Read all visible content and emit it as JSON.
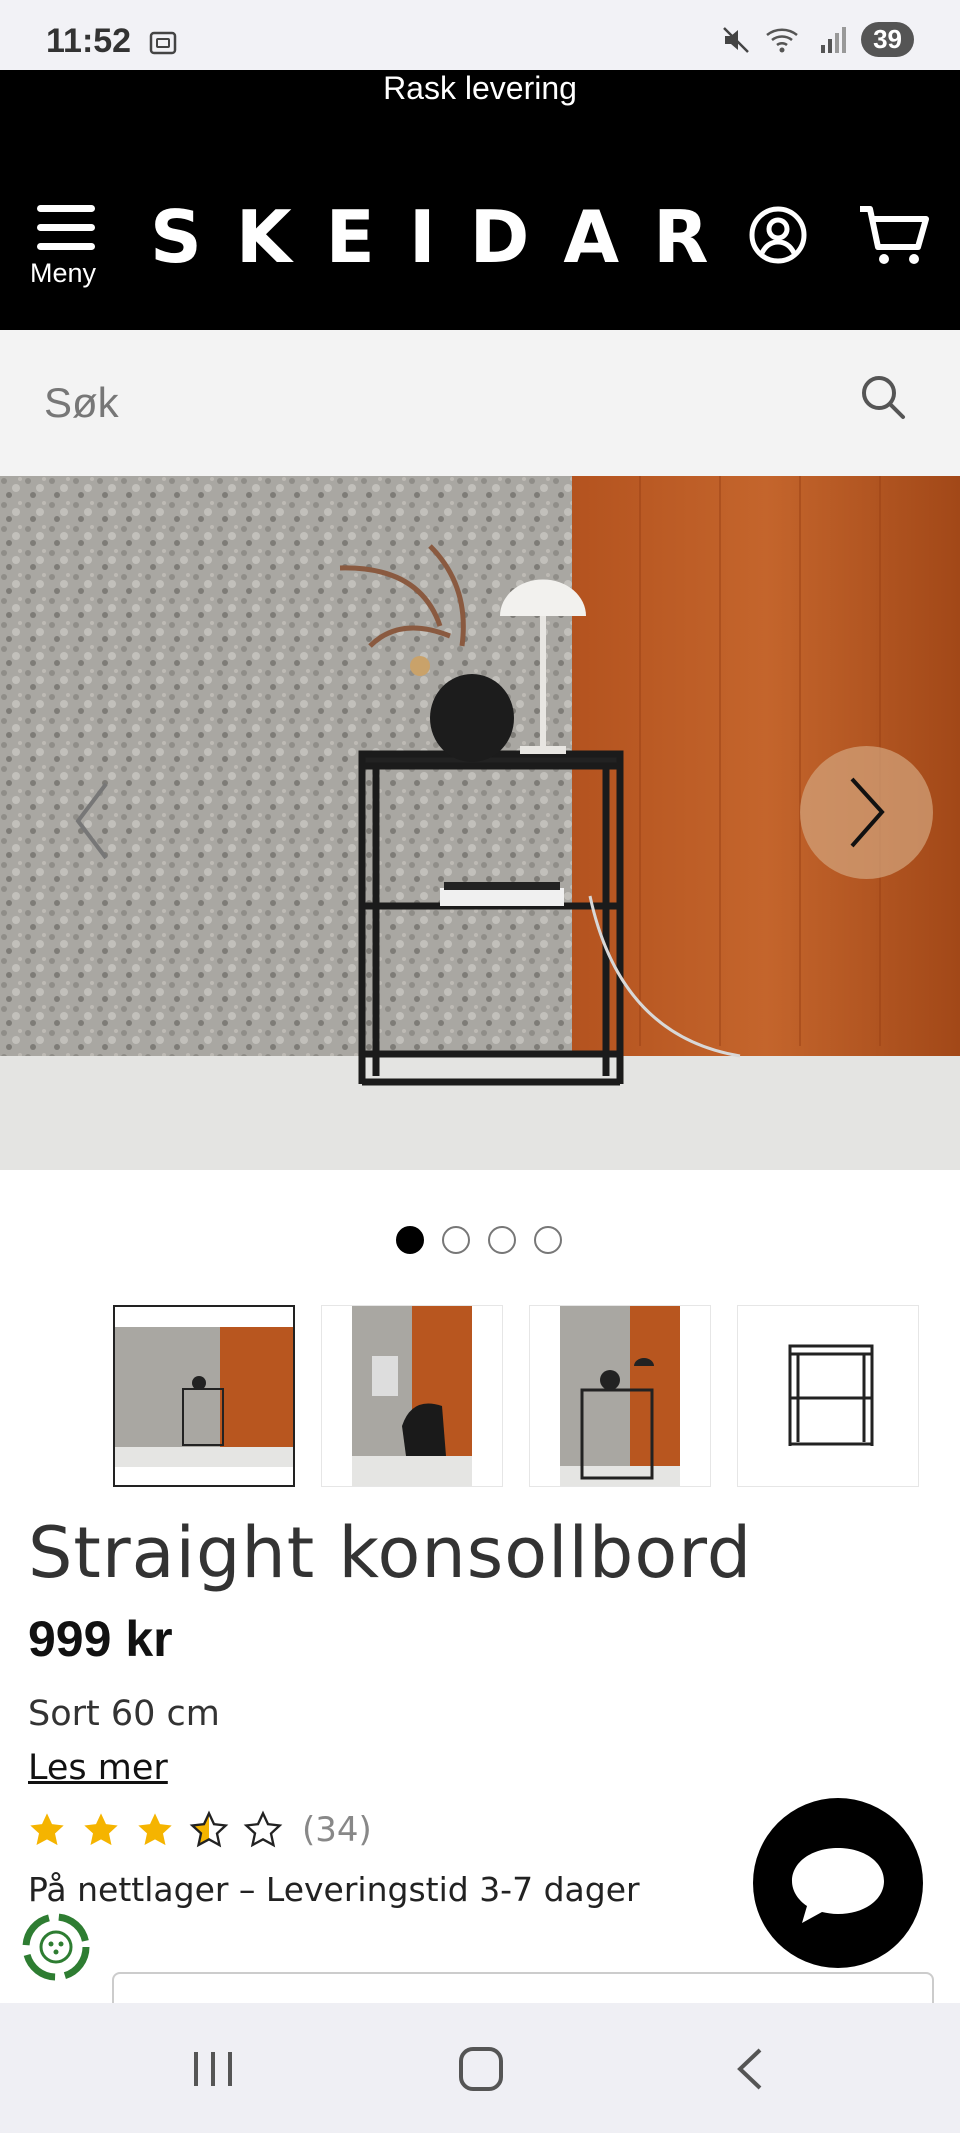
{
  "status_bar": {
    "time": "11:52",
    "battery": "39"
  },
  "header": {
    "promo": "Rask levering",
    "menu_label": "Meny",
    "logo": "SKEIDAR"
  },
  "search": {
    "placeholder": "Søk"
  },
  "gallery": {
    "active_index": 0,
    "dot_count": 4,
    "thumbnail_count": 4
  },
  "product": {
    "title": "Straight konsollbord",
    "price": "999 kr",
    "variant": "Sort 60 cm",
    "read_more": "Les mer",
    "rating": 3.5,
    "rating_max": 5,
    "review_count": "(34)",
    "stock": "På nettlager – Leveringstid 3-7 dager"
  },
  "icons": {
    "menu": "hamburger-icon",
    "account": "user-circle-icon",
    "cart": "cart-icon",
    "search": "search-icon",
    "chat": "chat-bubble-icon",
    "eco": "recycle-badge-icon"
  },
  "colors": {
    "header_bg": "#000000",
    "star": "#f5b400",
    "search_bg": "#f3f3f3"
  }
}
